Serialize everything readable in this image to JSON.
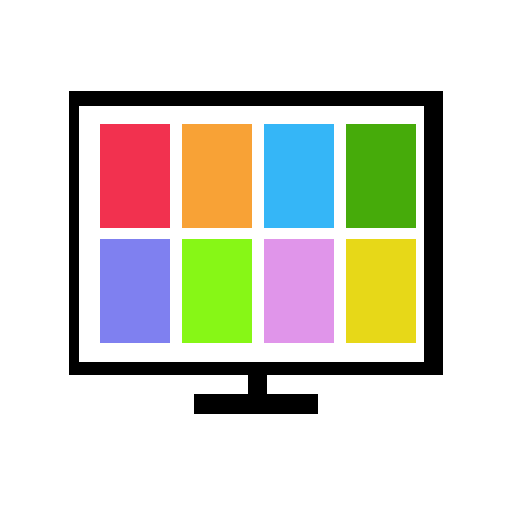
{
  "icon": {
    "name": "monitor-app-grid-icon",
    "frame_color": "#000000",
    "screen_color": "#ffffff",
    "tiles": [
      {
        "name": "red",
        "color": "#f2314f"
      },
      {
        "name": "orange",
        "color": "#f8a236"
      },
      {
        "name": "blue",
        "color": "#35b6f7"
      },
      {
        "name": "green",
        "color": "#46ab0a"
      },
      {
        "name": "periwinkle",
        "color": "#7f80f0"
      },
      {
        "name": "lime",
        "color": "#87f716"
      },
      {
        "name": "lilac",
        "color": "#e095ea"
      },
      {
        "name": "yellow",
        "color": "#e7d818"
      }
    ]
  }
}
